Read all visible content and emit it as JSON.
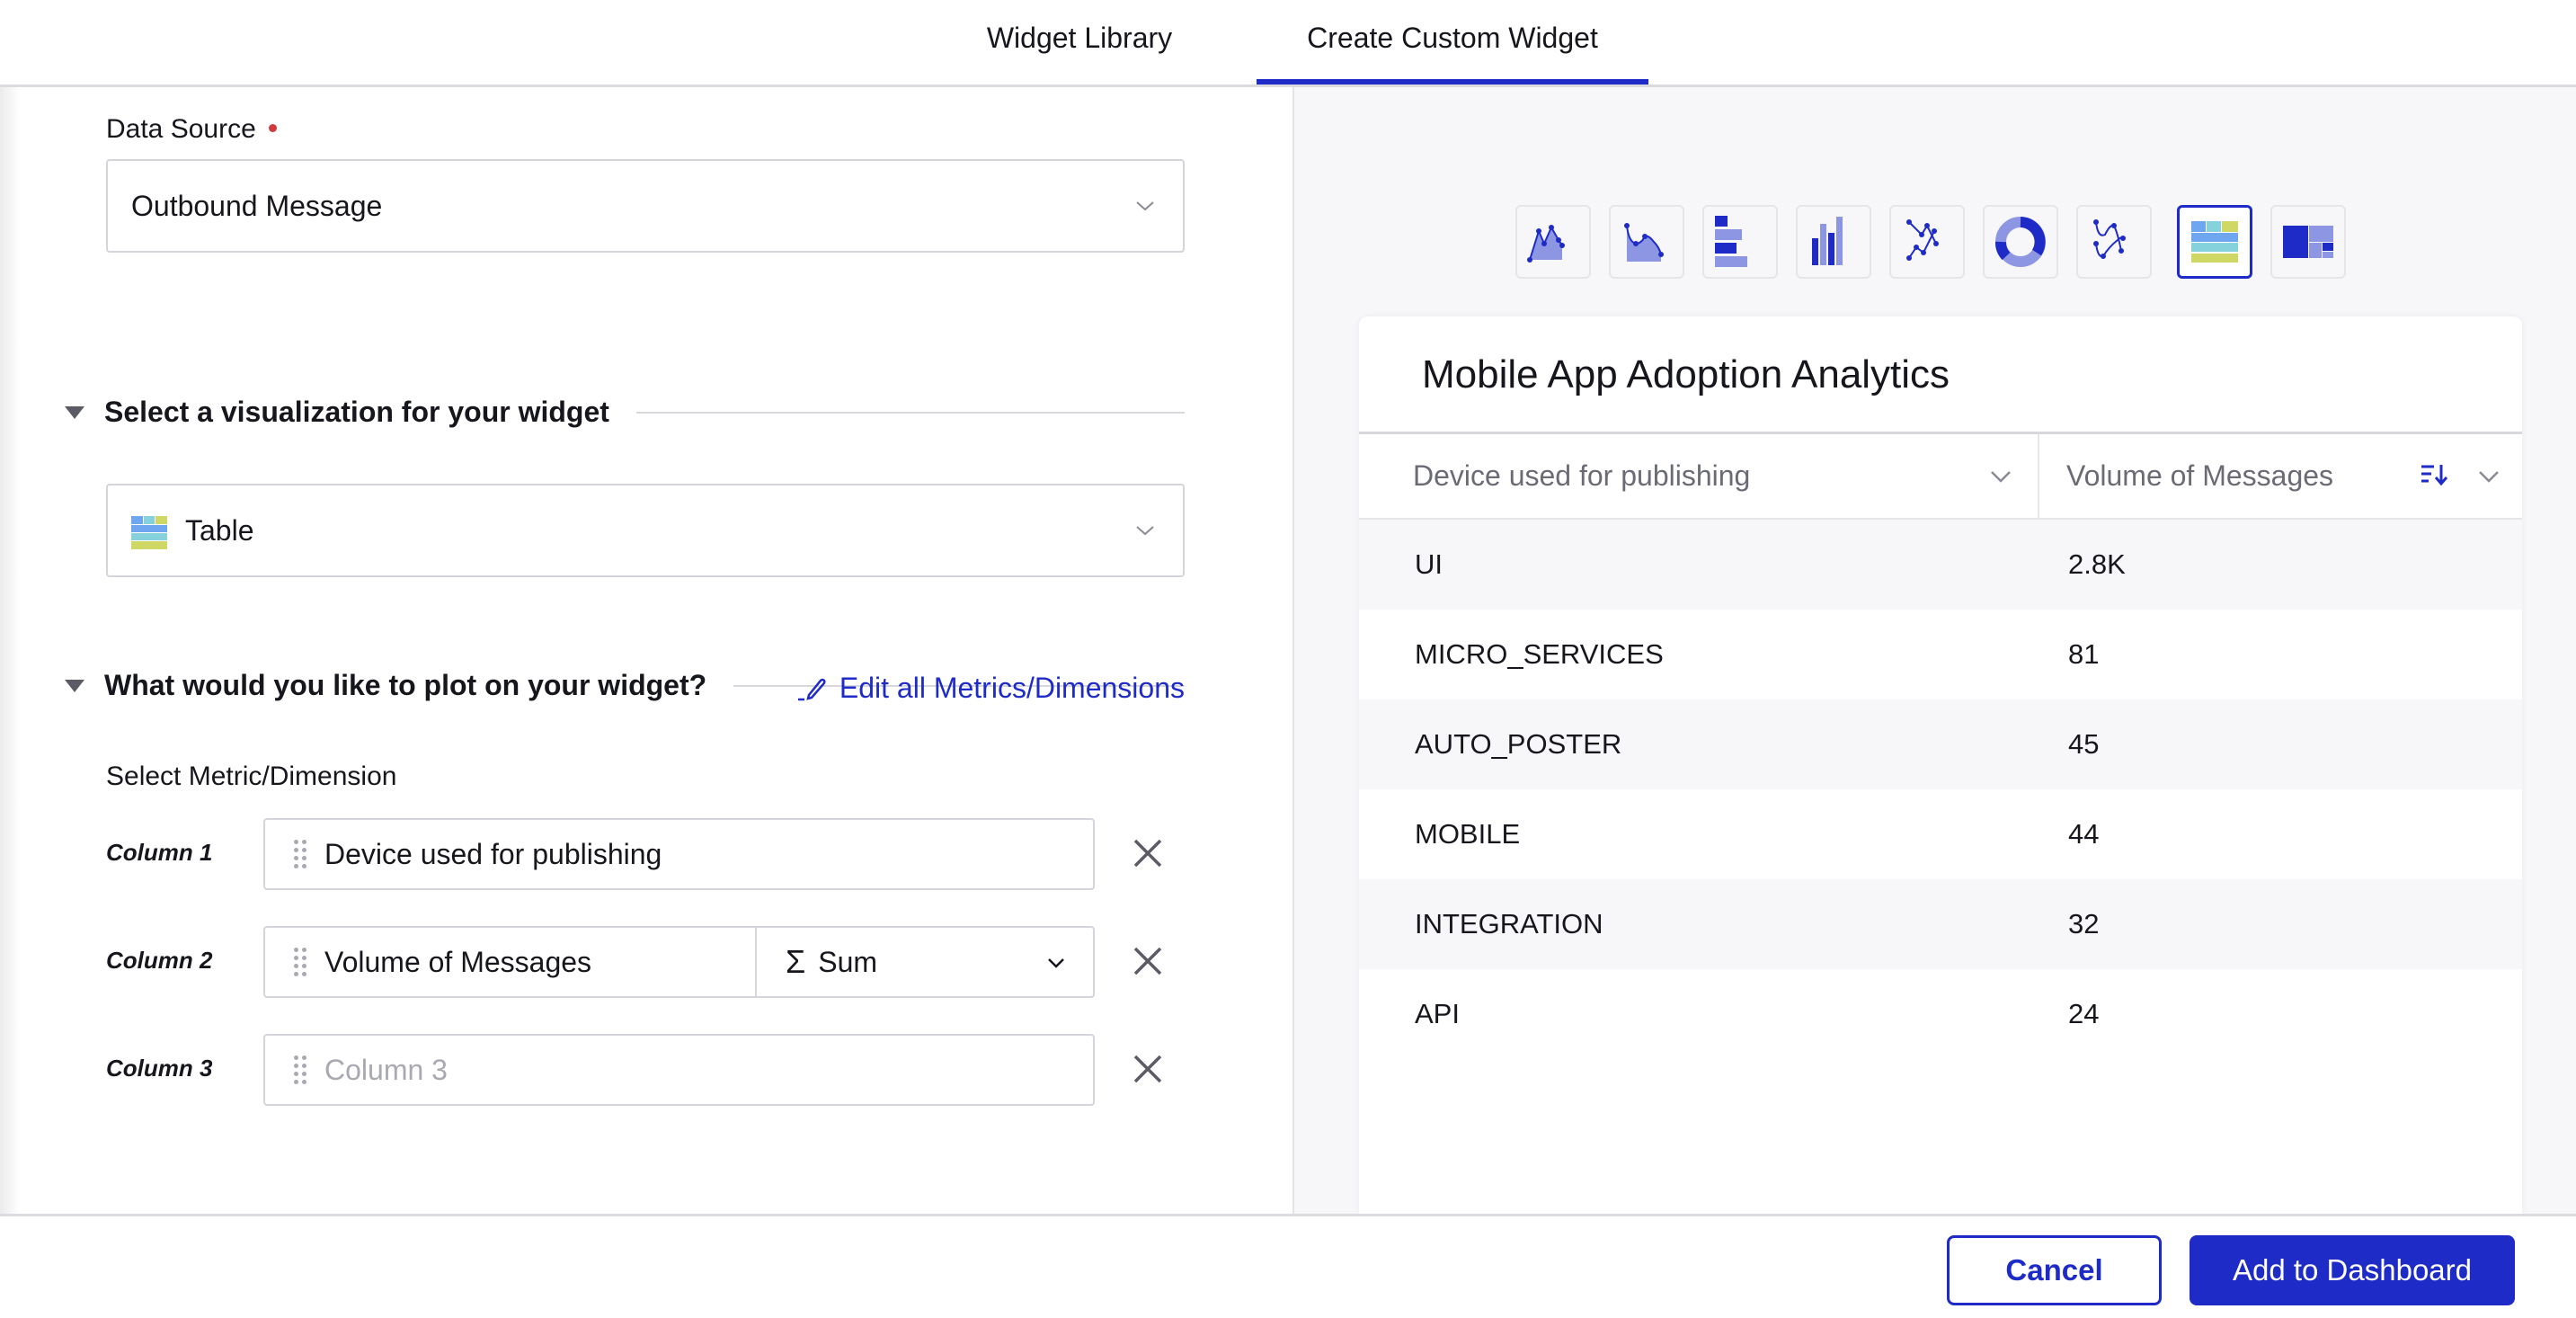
{
  "tabs": {
    "widget_library": "Widget Library",
    "create_custom_widget": "Create Custom Widget",
    "active": "create_custom_widget"
  },
  "colors": {
    "accent": "#1e2bc6",
    "required": "#d0393e",
    "panel_bg": "#f7f7f9"
  },
  "form": {
    "data_source": {
      "label": "Data Source",
      "required": true,
      "value": "Outbound Message",
      "icon": "chevron-down-icon"
    },
    "visualization": {
      "heading": "Select a visualization for your widget",
      "value": "Table",
      "icon": "table-chart-icon"
    },
    "plot": {
      "heading": "What would you like to plot on your widget?",
      "select_label": "Select Metric/Dimension",
      "edit_link": "Edit all Metrics/Dimensions",
      "columns": [
        {
          "label": "Column 1",
          "value": "Device used for publishing",
          "placeholder": ""
        },
        {
          "label": "Column 2",
          "value": "Volume of Messages",
          "aggregation": "Sum",
          "aggregation_icon": "Σ",
          "placeholder": ""
        },
        {
          "label": "Column 3",
          "value": "",
          "placeholder": "Column 3"
        }
      ]
    }
  },
  "viz_types": [
    {
      "name": "area-chart",
      "selected": false
    },
    {
      "name": "spline-area-chart",
      "selected": false
    },
    {
      "name": "horizontal-bar-chart",
      "selected": false
    },
    {
      "name": "vertical-bar-chart",
      "selected": false
    },
    {
      "name": "line-chart",
      "selected": false
    },
    {
      "name": "donut-chart",
      "selected": false
    },
    {
      "name": "spline-chart",
      "selected": false
    },
    {
      "name": "table",
      "selected": true
    },
    {
      "name": "treemap",
      "selected": false
    }
  ],
  "preview": {
    "title": "Mobile App Adoption Analytics",
    "columns": [
      {
        "header": "Device used for publishing"
      },
      {
        "header": "Volume of Messages",
        "sorted": "descending"
      }
    ],
    "rows": [
      [
        "UI",
        "2.8K"
      ],
      [
        "MICRO_SERVICES",
        "81"
      ],
      [
        "AUTO_POSTER",
        "45"
      ],
      [
        "MOBILE",
        "44"
      ],
      [
        "INTEGRATION",
        "32"
      ],
      [
        "API",
        "24"
      ]
    ]
  },
  "footer": {
    "cancel": "Cancel",
    "add": "Add to Dashboard"
  }
}
